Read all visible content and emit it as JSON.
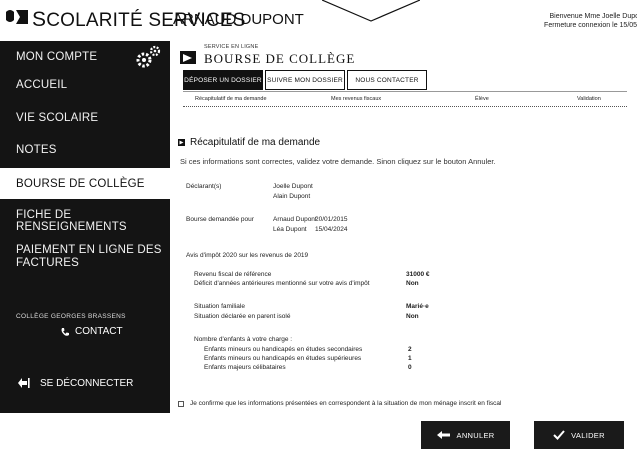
{
  "header": {
    "brand_initial": "S",
    "brand_rest": "COLARITÉ SERVICES",
    "user_name": "ARNAUD DUPONT",
    "welcome_line1": "Bienvenue Mme Joelle Dupo",
    "welcome_line2": "Fermeture connexion le 15/05/"
  },
  "sidebar": {
    "items": [
      {
        "label": "MON COMPTE"
      },
      {
        "label": "ACCUEIL"
      },
      {
        "label": "VIE SCOLAIRE"
      },
      {
        "label": "NOTES"
      },
      {
        "label": "BOURSE DE COLLÈGE"
      },
      {
        "label": "FICHE DE RENSEIGNEMENTS"
      },
      {
        "label": "PAIEMENT EN LIGNE DES"
      },
      {
        "label": "FACTURES"
      }
    ],
    "school_name": "COLLÈGE GEORGES BRASSENS",
    "contact_label": "CONTACT",
    "logout_label": "SE DÉCONNECTER"
  },
  "main": {
    "service_sup": "SERVICE EN LIGNE",
    "service_title": "BOURSE DE COLLÈGE",
    "tabs": [
      {
        "label": "DÉPOSER UN DOSSIER"
      },
      {
        "label": "SUIVRE MON DOSSIER"
      },
      {
        "label": "NOUS CONTACTER"
      }
    ],
    "steps": [
      {
        "label": "Récapitulatif de ma demande"
      },
      {
        "label": "Mes revenus fiscaux"
      },
      {
        "label": "Élève"
      },
      {
        "label": "Validation"
      }
    ],
    "section_title": "Récapitulatif de ma demande",
    "intro": "Si ces informations sont correctes, validez votre demande. Sinon cliquez sur le bouton Annuler.",
    "declarants_label": "Déclarant(s)",
    "declarant1": "Joelle Dupont",
    "declarant2": "Alain Dupont",
    "bourse_label": "Bourse demandée pour",
    "child1_name": "Arnaud Dupont",
    "child1_date": "20/01/2015",
    "child2_name": "Léa Dupont",
    "child2_date": "15/04/2024",
    "avis_title": "Avis d'impôt 2020 sur les revenus de 2019",
    "rfr_label": "Revenu fiscal de référence",
    "rfr_value": "31000 €",
    "deficit_label": "Déficit d'années antérieures mentionné sur votre avis d'impôt",
    "deficit_value": "Non",
    "situation_label": "Situation familiale",
    "situation_value": "Marié·e",
    "parent_isole_label": "Situation déclarée en parent isolé",
    "parent_isole_value": "Non",
    "charge_title": "Nombre d'enfants à votre charge :",
    "charge1_label": "Enfants mineurs ou handicapés en études secondaires",
    "charge1_value": "2",
    "charge2_label": "Enfants mineurs ou handicapés en études supérieures",
    "charge2_value": "1",
    "charge3_label": "Enfants majeurs célibataires",
    "charge3_value": "0",
    "confirm_text": "Je confirme que les informations présentées en correspondent à la situation de mon ménage inscrit en fiscal"
  },
  "footer": {
    "cancel_label": "ANNULER",
    "validate_label": "VALIDER"
  },
  "colors": {
    "sidebar_bg": "#141414",
    "button_bg": "#1a1a1a",
    "active_item_bg": "#ffffff"
  },
  "icons": [
    "logo-icon",
    "gear-icon",
    "phone-icon",
    "logout-icon",
    "service-icon",
    "arrow-left-icon",
    "check-icon"
  ]
}
